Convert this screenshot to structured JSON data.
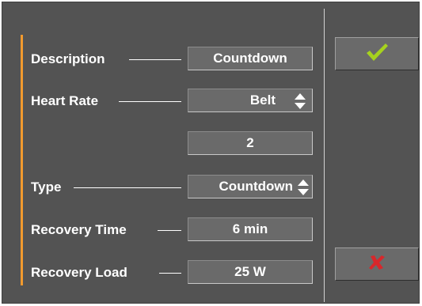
{
  "form": {
    "rows": [
      {
        "label": "Description",
        "value": "Countdown",
        "spinner": false
      },
      {
        "label": "Heart Rate",
        "value": "Belt",
        "spinner": true
      },
      {
        "label": "",
        "value": "2",
        "spinner": false
      },
      {
        "label": "Type",
        "value": "Countdown",
        "spinner": true
      },
      {
        "label": "Recovery Time",
        "value": "6 min",
        "spinner": false
      },
      {
        "label": "Recovery Load",
        "value": "25 W",
        "spinner": false
      }
    ]
  },
  "buttons": {
    "confirm_icon": "checkmark-icon",
    "cancel_icon": "cross-icon"
  },
  "colors": {
    "panel": "#535353",
    "accent": "#f29a2e",
    "confirm": "#a6d21e",
    "cancel": "#d8272b",
    "text": "#ffffff"
  }
}
